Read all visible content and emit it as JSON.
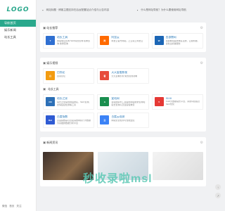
{
  "logo": "LOGO",
  "sidebar": {
    "items": [
      {
        "label": "导航首页",
        "active": true
      },
      {
        "label": "娱乐新闻"
      },
      {
        "label": "站长工具"
      }
    ],
    "footer": [
      "微信",
      "首页",
      "关注"
    ]
  },
  "topbar": {
    "notice1": "网站标题 · 博客主题支持在后台配置站点介绍与公告内容",
    "notice2": "什么是网址导航？为什么要使用网址导航"
  },
  "sections": {
    "hot": {
      "title": "站长推荐",
      "cards": [
        {
          "title": "站长工具",
          "desc": "网站信息查询 SEO综合查询 权重查询 收录查询",
          "color": "#2f6fd1",
          "thumb": "T"
        },
        {
          "title": "阿里云",
          "desc": "阿里云官方网站，上云就上阿里云",
          "color": "#ff6a00",
          "thumb": "阿"
        },
        {
          "title": "西部数码",
          "desc": "西部数码提供域名注册、云服务器、虚拟主机等服务",
          "color": "#1c66b5",
          "thumb": "W"
        }
      ]
    },
    "ent": {
      "title": "娱乐视频",
      "cards": [
        {
          "title": "白领论",
          "desc": "白领论坛",
          "color": "#f39c12",
          "thumb": "白"
        },
        {
          "title": "天天爱看影视",
          "desc": "天天爱看影视 免费在线观看",
          "color": "#e74c3c",
          "thumb": "看"
        }
      ]
    },
    "tools": {
      "title": "站长工具",
      "cards": [
        {
          "title": "站长之家",
          "desc": "站长之家提供网站排名、SEO查询、友情链接检测等工具",
          "color": "#2c6fb6",
          "thumb": "CN"
        },
        {
          "title": "爱站网",
          "desc": "爱站网站长工具提供网站收录查询和站长查询以及百度权重值",
          "color": "#1a8e4f",
          "thumb": "A"
        },
        {
          "title": "5118",
          "desc": "5118大数据站长平台，关键词挖掘及SEO优化",
          "color": "#e53935",
          "thumb": "5"
        },
        {
          "title": "百度指数",
          "desc": "百度指数是以百度海量网民行为数据为基础的数据分析平台",
          "color": "#2f5bd3",
          "thumb": "Bai"
        },
        {
          "title": "百度云观测",
          "desc": "网站安全检测与性能监控",
          "color": "#3b82f6",
          "thumb": "云"
        }
      ]
    },
    "news": {
      "title": "新闻资讯"
    }
  },
  "watermark": "秒收录啦msl"
}
